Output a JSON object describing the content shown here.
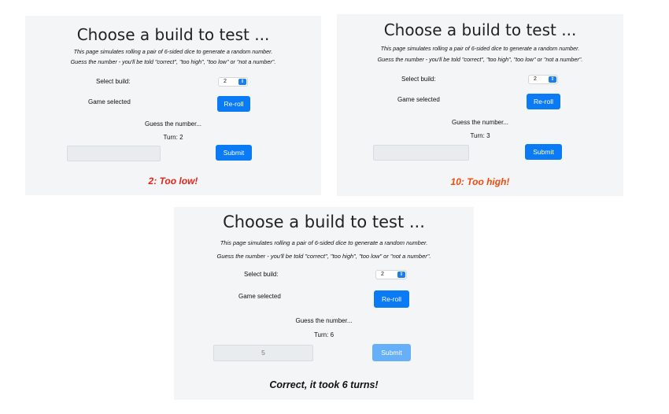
{
  "colors": {
    "too_low": "#e8231a",
    "too_high": "#f04a0c",
    "correct": "#111111",
    "button": "#0a7af5"
  },
  "panels": [
    {
      "title": "Choose a build to test ...",
      "desc_line1": "This page simulates rolling a pair of 6-sided dice to generate a random number.",
      "desc_line2": "Guess the number - you'll be told \"correct\", \"too high\", \"too low\" or \"not a number\".",
      "select_label": "Select build:",
      "select_value": "2",
      "game_label": "Game selected",
      "reroll_label": "Re-roll",
      "guess_label": "Guess the number...",
      "turn_text": "Turn: 2",
      "input_value": "",
      "submit_label": "Submit",
      "result_text": "2: Too low!"
    },
    {
      "title": "Choose a build to test ...",
      "desc_line1": "This page simulates rolling a pair of 6-sided dice to generate a random number.",
      "desc_line2": "Guess the number - you'll be told \"correct\", \"too high\", \"too low\" or \"not a number\".",
      "select_label": "Select build:",
      "select_value": "2",
      "game_label": "Game selected",
      "reroll_label": "Re-roll",
      "guess_label": "Guess the number...",
      "turn_text": "Turn: 3",
      "input_value": "",
      "submit_label": "Submit",
      "result_text": "10: Too high!"
    },
    {
      "title": "Choose a build to test ...",
      "desc_line1": "This page simulates rolling a pair of 6-sided dice to generate a random number.",
      "desc_line2": "Guess the number - you'll be told \"correct\", \"too high\", \"too low\" or \"not a number\".",
      "select_label": "Select build:",
      "select_value": "2",
      "game_label": "Game selected",
      "reroll_label": "Re-roll",
      "guess_label": "Guess the number...",
      "turn_text": "Turn: 6",
      "input_value": "5",
      "submit_label": "Submit",
      "result_text": "Correct, it took 6 turns!"
    }
  ]
}
